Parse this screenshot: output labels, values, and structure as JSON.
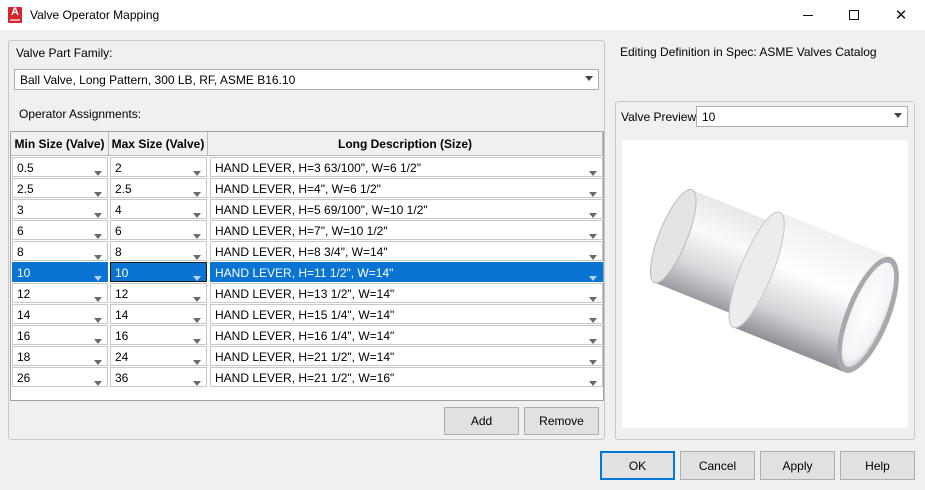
{
  "window": {
    "title": "Valve Operator Mapping",
    "icon": "autocad-plant-icon"
  },
  "left": {
    "family_label": "Valve Part Family:",
    "family_value": "Ball Valve, Long Pattern, 300 LB, RF, ASME B16.10",
    "assignments_label": "Operator Assignments:",
    "columns": [
      "Min Size (Valve)",
      "Max Size (Valve)",
      "Long Description (Size)"
    ],
    "rows": [
      {
        "min": "0.5",
        "max": "2",
        "desc": "HAND LEVER, H=3 63/100\", W=6 1/2\""
      },
      {
        "min": "2.5",
        "max": "2.5",
        "desc": "HAND LEVER, H=4\", W=6 1/2\""
      },
      {
        "min": "3",
        "max": "4",
        "desc": "HAND LEVER, H=5 69/100\", W=10 1/2\""
      },
      {
        "min": "6",
        "max": "6",
        "desc": "HAND LEVER, H=7\", W=10 1/2\""
      },
      {
        "min": "8",
        "max": "8",
        "desc": "HAND LEVER, H=8 3/4\", W=14\""
      },
      {
        "min": "10",
        "max": "10",
        "desc": "HAND LEVER, H=11 1/2\", W=14\""
      },
      {
        "min": "12",
        "max": "12",
        "desc": "HAND LEVER, H=13 1/2\", W=14\""
      },
      {
        "min": "14",
        "max": "14",
        "desc": "HAND LEVER, H=15 1/4\", W=14\""
      },
      {
        "min": "16",
        "max": "16",
        "desc": "HAND LEVER, H=16 1/4\", W=14\""
      },
      {
        "min": "18",
        "max": "24",
        "desc": "HAND LEVER, H=21 1/2\", W=14\""
      },
      {
        "min": "26",
        "max": "36",
        "desc": "HAND LEVER, H=21 1/2\", W=16\""
      }
    ],
    "selected_row": 5,
    "add_label": "Add",
    "remove_label": "Remove"
  },
  "right": {
    "spec_label": "Editing Definition in Spec: ASME Valves Catalog",
    "preview_label": "Valve Preview:",
    "preview_value": "10"
  },
  "footer": {
    "ok": "OK",
    "cancel": "Cancel",
    "apply": "Apply",
    "help": "Help"
  },
  "colors": {
    "selection": "#0a74d4",
    "default_button_border": "#0078d7"
  }
}
